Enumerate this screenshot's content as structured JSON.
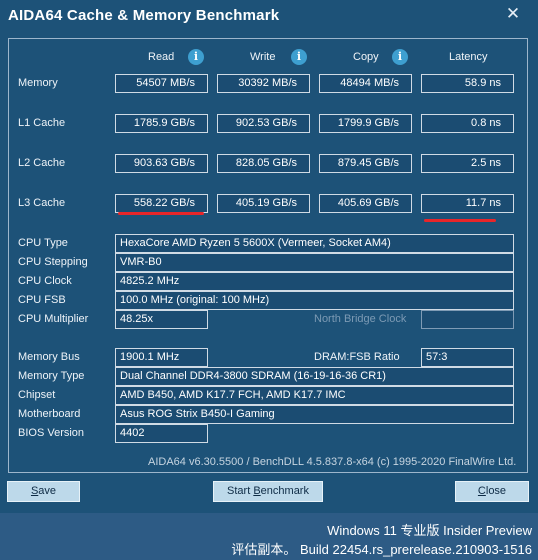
{
  "window": {
    "title": "AIDA64 Cache & Memory Benchmark",
    "close_glyph": "✕"
  },
  "headers": {
    "read": "Read",
    "write": "Write",
    "copy": "Copy",
    "latency": "Latency",
    "info_glyph": "i"
  },
  "rows": [
    {
      "label": "Memory",
      "read": "54507 MB/s",
      "write": "30392 MB/s",
      "copy": "48494 MB/s",
      "latency": "58.9 ns"
    },
    {
      "label": "L1 Cache",
      "read": "1785.9 GB/s",
      "write": "902.53 GB/s",
      "copy": "1799.9 GB/s",
      "latency": "0.8 ns"
    },
    {
      "label": "L2 Cache",
      "read": "903.63 GB/s",
      "write": "828.05 GB/s",
      "copy": "879.45 GB/s",
      "latency": "2.5 ns"
    },
    {
      "label": "L3 Cache",
      "read": "558.22 GB/s",
      "write": "405.19 GB/s",
      "copy": "405.69 GB/s",
      "latency": "11.7 ns"
    }
  ],
  "cpu": {
    "type_label": "CPU Type",
    "type": "HexaCore AMD Ryzen 5 5600X  (Vermeer, Socket AM4)",
    "stepping_label": "CPU Stepping",
    "stepping": "VMR-B0",
    "clock_label": "CPU Clock",
    "clock": "4825.2 MHz",
    "fsb_label": "CPU FSB",
    "fsb": "100.0 MHz  (original: 100 MHz)",
    "multiplier_label": "CPU Multiplier",
    "multiplier": "48.25x",
    "north_bridge_label": "North Bridge Clock",
    "north_bridge": ""
  },
  "memory": {
    "bus_label": "Memory Bus",
    "bus": "1900.1 MHz",
    "ratio_label": "DRAM:FSB Ratio",
    "ratio": "57:3",
    "type_label": "Memory Type",
    "type": "Dual Channel DDR4-3800 SDRAM  (16-19-16-36 CR1)",
    "chipset_label": "Chipset",
    "chipset": "AMD B450, AMD K17.7 FCH, AMD K17.7 IMC",
    "motherboard_label": "Motherboard",
    "motherboard": "Asus ROG Strix B450-I Gaming",
    "bios_label": "BIOS Version",
    "bios": "4402"
  },
  "footer": "AIDA64 v6.30.5500 / BenchDLL 4.5.837.8-x64  (c) 1995-2020 FinalWire Ltd.",
  "buttons": {
    "save_u": "S",
    "save_rest": "ave",
    "start_pre": "Start ",
    "start_u": "B",
    "start_rest": "enchmark",
    "close_u": "C",
    "close_rest": "lose"
  },
  "watermark": {
    "line1": "Windows 11 专业版 Insider Preview",
    "line2": "评估副本。 Build 22454.rs_prerelease.210903-1516"
  },
  "colors": {
    "window_bg": "#1d5278",
    "button_bg": "#bdd9ea",
    "highlight_underline": "#e8262a"
  }
}
